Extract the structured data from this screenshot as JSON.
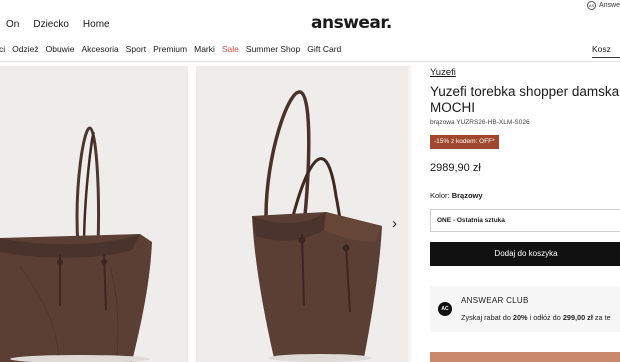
{
  "top_nav": {
    "links": [
      "On",
      "Dziecko",
      "Home"
    ],
    "logo": "answear.",
    "lang_label": "Answe",
    "lang_icon": "AS"
  },
  "categories": {
    "items": [
      "ci",
      "Odzież",
      "Obuwie",
      "Akcesoria",
      "Sport",
      "Premium",
      "Marki",
      "Sale",
      "Summer Shop",
      "Gift Card"
    ],
    "sale_color": "#d94a4a",
    "search_text": "Kosz"
  },
  "gallery": {
    "next_icon": "chevron-right-icon",
    "bag_color": "#5b3f35"
  },
  "product": {
    "brand": "Yuzefi",
    "title_line1": "Yuzefi torebka shopper damska",
    "title_line2": "MOCHI",
    "sku": "brązowa YUZRS26-HB-XLM-S026",
    "promo": "-15% z kodem: OFF*",
    "promo_color": "#a0472e",
    "price": "2989,90 zł",
    "color_label": "Kolor: ",
    "color_value": "Brązowy",
    "size": "ONE - Ostatnia sztuka",
    "add_to_cart": "Dodaj do koszyka"
  },
  "club": {
    "badge": "AC",
    "title": "ANSWEAR CLUB",
    "text_before": "Zyskaj rabat do ",
    "discount": "20%",
    "text_middle": " i odłóż do ",
    "amount": "299,00 zł",
    "text_after": " za te"
  }
}
